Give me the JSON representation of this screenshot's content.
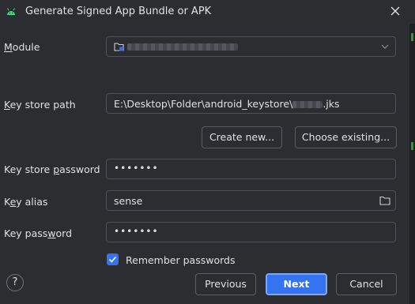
{
  "dialog": {
    "title": "Generate Signed App Bundle or APK",
    "icons": {
      "app": "android-icon",
      "close": "close-icon"
    }
  },
  "module": {
    "label_accel": "M",
    "label_rest": "odule",
    "icon": "module-folder-icon"
  },
  "key_store_path": {
    "label_accel": "K",
    "label_rest": "ey store path",
    "value_prefix": "E:\\Desktop\\Folder\\android_keystore\\",
    "value_suffix": ".jks"
  },
  "buttons": {
    "create_new": "Create new...",
    "choose_existing": "Choose existing...",
    "previous": "Previous",
    "next": "Next",
    "cancel": "Cancel",
    "help": "?"
  },
  "key_store_password": {
    "label_pre": "Key store ",
    "label_accel": "p",
    "label_rest": "assword",
    "value": "•••••••"
  },
  "key_alias": {
    "label_pre": "K",
    "label_accel": "e",
    "label_rest": "y alias",
    "value": "sense",
    "icon": "folder-icon"
  },
  "key_password": {
    "label_pre": "Key pass",
    "label_accel": "w",
    "label_rest": "ord",
    "value": "•••••••"
  },
  "remember": {
    "label": "Remember passwords",
    "checked": true
  },
  "colors": {
    "background": "#2b2d30",
    "accent": "#3574f0",
    "text": "#dfe1e5",
    "border": "#4e5157"
  }
}
